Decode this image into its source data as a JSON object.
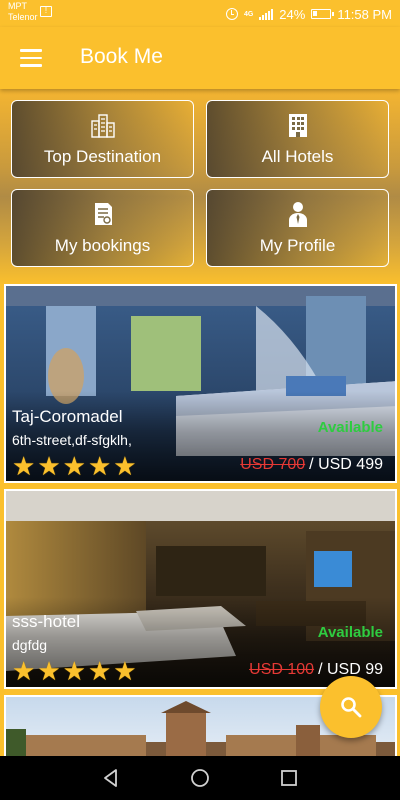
{
  "status_bar": {
    "carrier_line1": "MPT",
    "carrier_line2": "Telenor",
    "network": "4G",
    "battery": "24%",
    "time": "11:58 PM"
  },
  "app_bar": {
    "title": "Book Me",
    "menu_icon": "hamburger-menu-icon"
  },
  "menu": [
    {
      "label": "Top Destination",
      "icon": "city-buildings-icon"
    },
    {
      "label": "All Hotels",
      "icon": "hotel-building-icon"
    },
    {
      "label": "My bookings",
      "icon": "document-icon"
    },
    {
      "label": "My Profile",
      "icon": "person-icon"
    }
  ],
  "hotels": [
    {
      "name": "Taj-Coromadel",
      "address": "6th-street,df-sfgklh,",
      "rating": 5,
      "availability": "Available",
      "old_price": "USD 700",
      "price": "USD 499",
      "price_separator": "/"
    },
    {
      "name": "sss-hotel",
      "address": "dgfdg",
      "rating": 5,
      "availability": "Available",
      "old_price": "USD 100",
      "price": "USD 99",
      "price_separator": "/"
    }
  ],
  "fab": {
    "icon": "search-icon"
  },
  "nav_bar": {
    "back_icon": "back-icon",
    "home_icon": "home-icon",
    "recents_icon": "recents-icon"
  },
  "colors": {
    "primary": "#fbc02d",
    "available": "#2ecc40",
    "old_price": "#e53935",
    "star": "#fbc02d"
  }
}
